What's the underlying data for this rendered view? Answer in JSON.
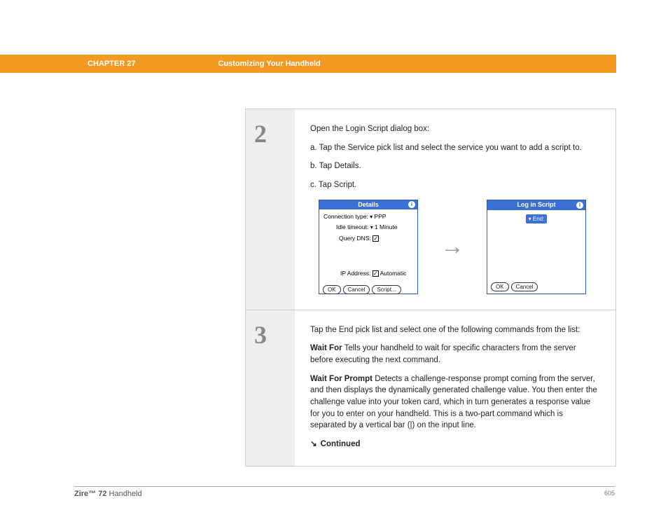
{
  "header": {
    "chapter": "CHAPTER 27",
    "title": "Customizing Your Handheld"
  },
  "steps": {
    "step2": {
      "number": "2",
      "intro": "Open the Login Script dialog box:",
      "a": "a.  Tap the Service pick list and select the service you want to add a script to.",
      "b": "b.  Tap Details.",
      "c": "c.  Tap Script.",
      "details_dialog": {
        "title": "Details",
        "conn_label": "Connection type:",
        "conn_value": "PPP",
        "idle_label": "Idle timeout:",
        "idle_value": "1 Minute",
        "dns_label": "Query DNS:",
        "ip_label": "IP Address:",
        "ip_value": "Automatic",
        "ok": "OK",
        "cancel": "Cancel",
        "script": "Script..."
      },
      "login_dialog": {
        "title": "Log in Script",
        "end_value": "End:",
        "ok": "OK",
        "cancel": "Cancel"
      }
    },
    "step3": {
      "number": "3",
      "intro": "Tap the End pick list and select one of the following commands from the list:",
      "wait_for_label": "Wait For",
      "wait_for_text": "   Tells your handheld to wait for specific characters from the server before executing the next command.",
      "wait_prompt_label": "Wait For Prompt",
      "wait_prompt_text": "   Detects a challenge-response prompt coming from the server, and then displays the dynamically generated challenge value. You then enter the challenge value into your token card, which in turn generates a response value for you to enter on your handheld. This is a two-part command which is separated by a vertical bar (|) on the input line.",
      "continued": "Continued"
    }
  },
  "footer": {
    "product_bold": "Zire™ 72",
    "product_rest": " Handheld",
    "page": "605"
  }
}
